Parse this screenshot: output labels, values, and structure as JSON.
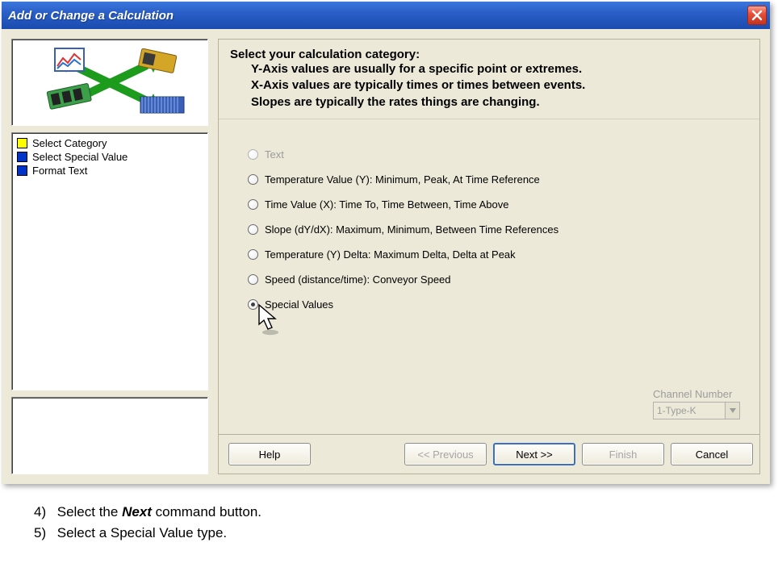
{
  "window": {
    "title": "Add or Change a Calculation"
  },
  "steps": [
    {
      "color": "#ffff00",
      "label": "Select Category"
    },
    {
      "color": "#0033cc",
      "label": "Select Special Value"
    },
    {
      "color": "#0033cc",
      "label": "Format Text"
    }
  ],
  "heading": {
    "main": "Select your calculation category:",
    "sub1": "Y-Axis values are usually for a specific point or extremes.",
    "sub2": "X-Axis values are typically times or times between events.",
    "sub3": "Slopes are typically the rates things are changing."
  },
  "options": {
    "text": "Text",
    "tempY": "Temperature Value (Y):  Minimum, Peak, At Time Reference",
    "timeX": "Time Value (X):  Time To, Time Between, Time Above",
    "slope": "Slope (dY/dX):  Maximum, Minimum, Between Time References",
    "tempDelta": "Temperature (Y) Delta:  Maximum Delta, Delta at Peak",
    "speed": "Speed (distance/time): Conveyor Speed",
    "special": "Special  Values"
  },
  "channel": {
    "label": "Channel Number",
    "value": "1-Type-K"
  },
  "buttons": {
    "help": "Help",
    "prev": "<< Previous",
    "next": "Next >>",
    "finish": "Finish",
    "cancel": "Cancel"
  },
  "instructions": {
    "n4": "4)",
    "t4a": "Select the ",
    "t4b": "Next",
    "t4c": " command button.",
    "n5": "5)",
    "t5": "Select a Special Value type."
  }
}
